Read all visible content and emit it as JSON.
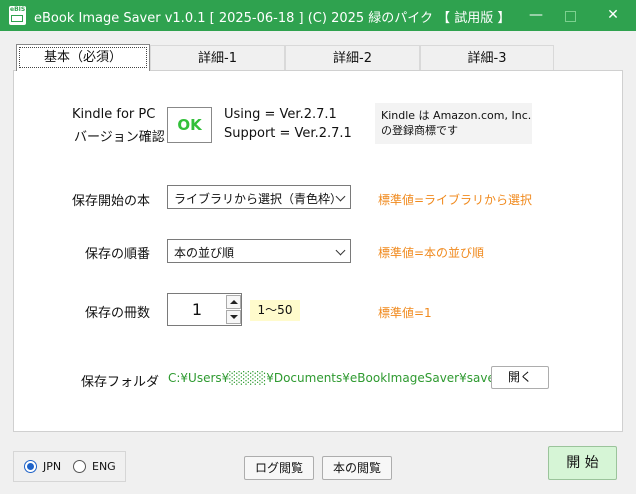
{
  "window": {
    "title": "eBook Image Saver  v1.0.1 [ 2025-06-18 ]  (C) 2025 緑のパイク  【 試用版 】",
    "icon_text": "eBIS",
    "controls": {
      "minimize": "—",
      "close": "✕"
    }
  },
  "tabs": [
    "基本（必須）",
    "詳細-1",
    "詳細-2",
    "詳細-3"
  ],
  "kindle": {
    "label_line1": "Kindle for PC",
    "label_line2": "バージョン確認",
    "status": "OK",
    "using": "Using    = Ver.2.7.1",
    "support": "Support  = Ver.2.7.1",
    "trademark_line1": "Kindle は Amazon.com, Inc.",
    "trademark_line2": "の登録商標です"
  },
  "start_book": {
    "label": "保存開始の本",
    "value": "ライブラリから選択（青色枠）",
    "hint": "標準値=ライブラリから選択"
  },
  "order": {
    "label": "保存の順番",
    "value": "本の並び順",
    "hint": "標準値=本の並び順"
  },
  "count": {
    "label": "保存の冊数",
    "value": "1",
    "range": "1〜50",
    "hint": "標準値=1"
  },
  "folder": {
    "label": "保存フォルダ",
    "path": "C:¥Users¥░░░░¥Documents¥eBookImageSaver¥save",
    "open_button": "開く"
  },
  "language": {
    "options": [
      "JPN",
      "ENG"
    ],
    "selected": "JPN"
  },
  "buttons": {
    "log": "ログ閲覧",
    "book": "本の閲覧",
    "start": "開 始"
  },
  "colors": {
    "titlebar": "#2fa24f",
    "ok": "#32c03a",
    "hint": "#f08a1e",
    "path": "#2e9a30",
    "start_bg": "#d6f5d6"
  }
}
